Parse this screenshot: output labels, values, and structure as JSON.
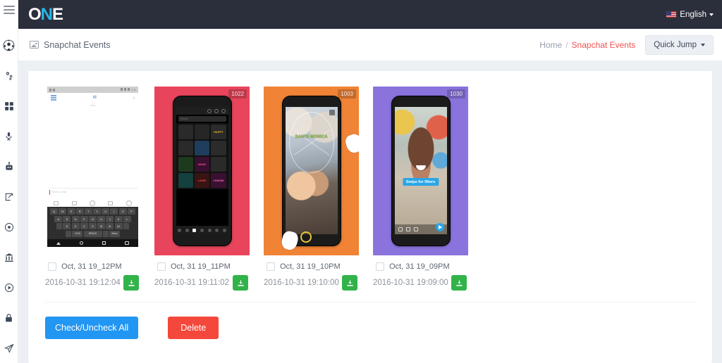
{
  "topbar": {
    "logo": {
      "o": "O",
      "n": "N",
      "e": "E"
    },
    "language": "English",
    "flag_icon": "us-flag-icon"
  },
  "breadcrumb_bar": {
    "page_icon": "image-icon",
    "page_title": "Snapchat Events",
    "crumbs": {
      "home": "Home",
      "separator": "/",
      "current": "Snapchat Events"
    },
    "quick_jump": "Quick Jump"
  },
  "sidebar": {
    "menu_toggle": "hamburger-icon",
    "items": [
      {
        "icon": "soccer-ball-icon",
        "label": ""
      },
      {
        "icon": "gears-icon",
        "label": ""
      },
      {
        "icon": "grid-apps-icon",
        "label": ""
      },
      {
        "icon": "microphone-icon",
        "label": ""
      },
      {
        "icon": "robot-icon",
        "label": ""
      },
      {
        "icon": "edit-square-icon",
        "label": ""
      },
      {
        "icon": "target-record-icon",
        "label": ""
      },
      {
        "icon": "bank-icon",
        "label": ""
      },
      {
        "icon": "play-circle-icon",
        "label": ""
      },
      {
        "icon": "lock-icon",
        "label": ""
      },
      {
        "icon": "paper-plane-icon",
        "label": ""
      }
    ]
  },
  "events": [
    {
      "badge": "",
      "label": "Oct, 31 19_12PM",
      "timestamp": "2016-10-31 19:12:04",
      "download_icon": "download-icon",
      "thumb_type": "chat-keyboard-screenshot",
      "accent": "#ffffff"
    },
    {
      "badge": "1022",
      "label": "Oct, 31 19_11PM",
      "timestamp": "2016-10-31 19:11:02",
      "download_icon": "download-icon",
      "thumb_type": "sticker-grid-screenshot",
      "accent": "#e8455c"
    },
    {
      "badge": "1003",
      "label": "Oct, 31 19_10PM",
      "timestamp": "2016-10-31 19:10:00",
      "download_icon": "download-icon",
      "thumb_type": "selfie-geofilter-screenshot",
      "accent": "#f08336"
    },
    {
      "badge": "1030",
      "label": "Oct, 31 19_09PM",
      "timestamp": "2016-10-31 19:09:00",
      "download_icon": "download-icon",
      "thumb_type": "swipe-filters-screenshot",
      "accent": "#8b73dd"
    }
  ],
  "thumb1": {
    "status_text": "7:11",
    "nav_title": "M",
    "nav_subtitle": "chat",
    "input_placeholder": "Send a chat",
    "keys_row1": [
      "Q",
      "W",
      "E",
      "R",
      "T",
      "Y",
      "U",
      "I",
      "O",
      "P"
    ],
    "keys_row2": [
      "A",
      "S",
      "D",
      "F",
      "G",
      "H",
      "J",
      "K",
      "L"
    ],
    "keys_row3": [
      "Z",
      "X",
      "C",
      "V",
      "B",
      "N",
      "M"
    ],
    "key_space": "SPACE",
    "key_num": "?123",
    "key_send": "Send"
  },
  "thumb2": {
    "search_placeholder": "Search",
    "stickers": [
      {
        "text": "",
        "bg": "#2a2a2a"
      },
      {
        "text": "",
        "bg": "#262626"
      },
      {
        "text": "HAPPY",
        "bg": "#2b2b2b"
      },
      {
        "text": "",
        "bg": "#2a2a2a"
      },
      {
        "text": "",
        "bg": "#1f3d5c"
      },
      {
        "text": "",
        "bg": "#2b2b2b"
      },
      {
        "text": "",
        "bg": "#1e3a1e"
      },
      {
        "text": "WOW",
        "bg": "#3a1030"
      },
      {
        "text": "",
        "bg": "#2a2a2a"
      },
      {
        "text": "",
        "bg": "#14403f"
      },
      {
        "text": "LOVE",
        "bg": "#3a1414"
      },
      {
        "text": "I KNOW",
        "bg": "#3a1030"
      }
    ]
  },
  "thumb3": {
    "geofilter_text": "SANTA\nMONICA"
  },
  "thumb4": {
    "tooltip": "Swipe for filters"
  },
  "footer": {
    "check_all": "Check/Uncheck All",
    "delete": "Delete"
  },
  "colors": {
    "header_bg": "#2b2e3b",
    "page_bg": "#eceff3",
    "accent_red": "#ef5350",
    "primary_blue": "#2196f3",
    "danger_red": "#f4483c",
    "download_green": "#31b34a",
    "logo_blue": "#29b6e8"
  }
}
